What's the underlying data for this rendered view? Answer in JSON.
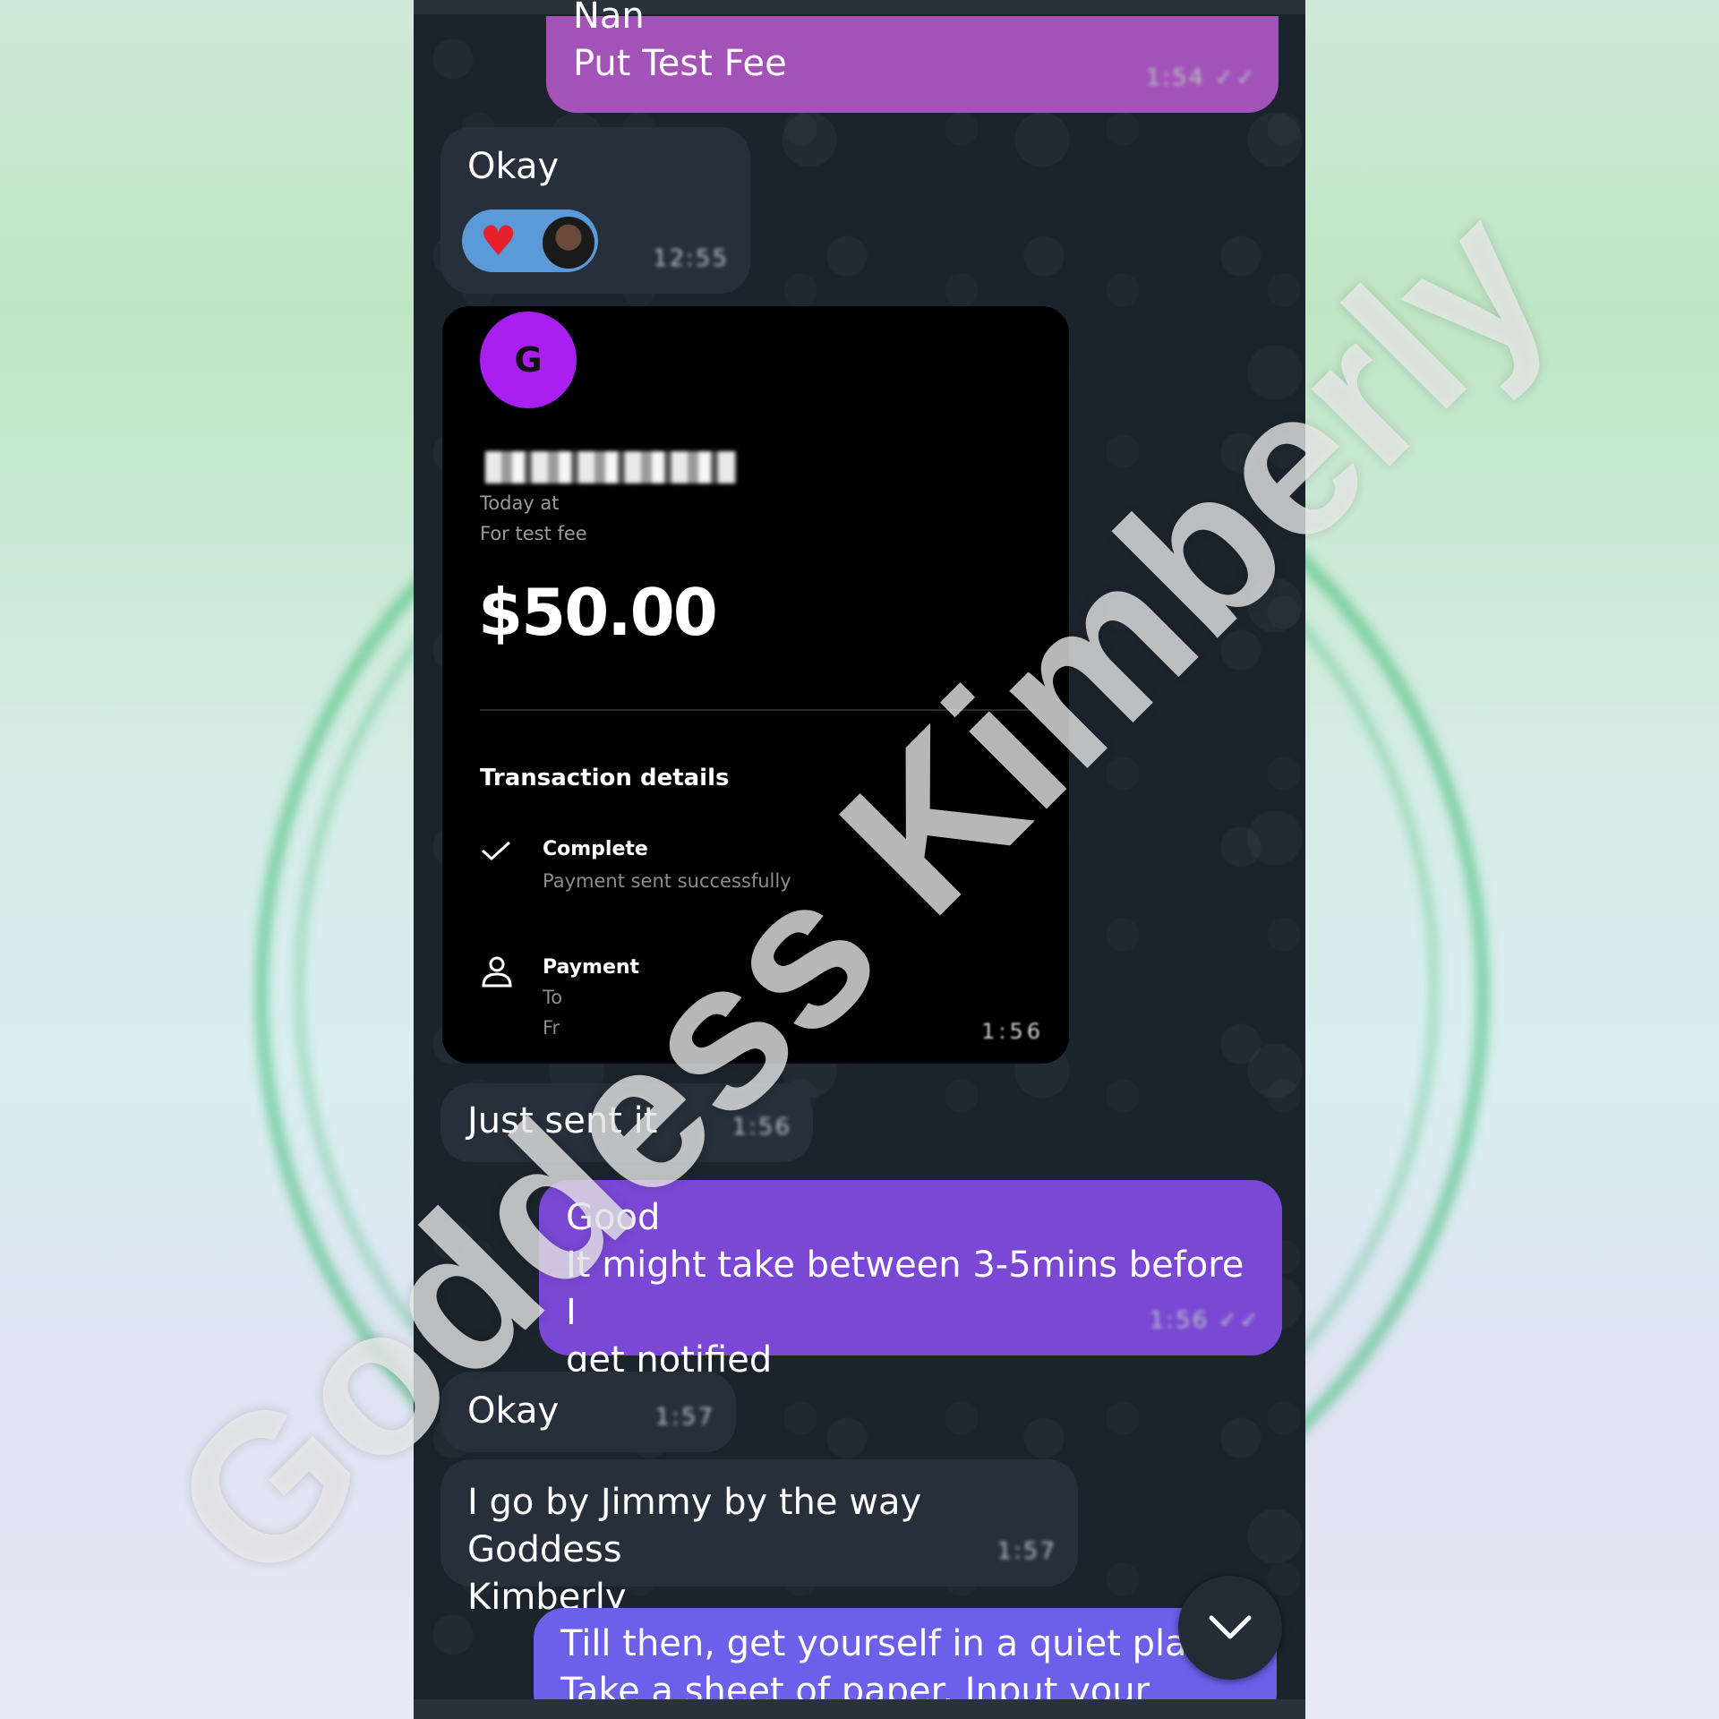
{
  "watermark": "Goddess Kimberly",
  "messages": {
    "out_1": {
      "line1": "Nan",
      "line2": "Put Test Fee",
      "meta": "1:54 ✓✓"
    },
    "in_okay1": {
      "text": "Okay",
      "reactions": [
        "heart",
        "avatar"
      ],
      "meta": "12:55"
    },
    "card": {
      "avatar_letter": "G",
      "today_label": "Today at",
      "note": "For test fee",
      "amount": "$50.00",
      "details_title": "Transaction details",
      "status_title": "Complete",
      "status_subtitle": "Payment sent successfully",
      "payment_label": "Payment",
      "to_label": "To",
      "from_label": "Fr",
      "meta": "1:56"
    },
    "in_just": {
      "text": "Just sent it",
      "meta": "1:56"
    },
    "out_2": {
      "text": "Good\nIt might take between 3-5mins before I\nget notified",
      "meta": "1:56 ✓✓"
    },
    "in_okay2": {
      "text": "Okay",
      "meta": "1:57"
    },
    "in_jimmy": {
      "text": "I go by Jimmy by the way Goddess\nKimberly",
      "meta": "1:57"
    },
    "out_3": {
      "text": "Till then, get yourself in a quiet place\nTake a sheet of paper. Input your name"
    }
  },
  "colors": {
    "chat_bg": "#1b232d",
    "incoming_bubble": "#262f3a",
    "outgoing_1": "#a352b8",
    "outgoing_2": "#7a48d4",
    "outgoing_3": "#6c60ea",
    "card_avatar": "#a81ff0"
  },
  "icons": [
    "heart-icon",
    "check-icon",
    "person-icon",
    "chevron-down-icon"
  ]
}
